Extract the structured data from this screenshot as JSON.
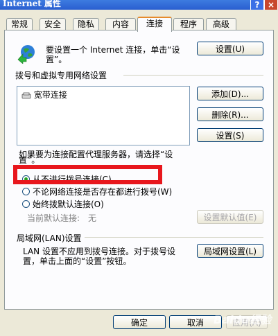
{
  "window": {
    "title": "Internet 属性",
    "help": "?",
    "close": "×"
  },
  "tabs": [
    {
      "label": "常规"
    },
    {
      "label": "安全"
    },
    {
      "label": "隐私"
    },
    {
      "label": "内容"
    },
    {
      "label": "连接"
    },
    {
      "label": "程序"
    },
    {
      "label": "高级"
    }
  ],
  "setup": {
    "text_line1": "要设置一个 Internet 连接，单击“设",
    "text_line2": "置”。",
    "button": "设置(U)"
  },
  "dialup": {
    "heading": "拨号和虚拟专用网络设置",
    "items": [
      "宽带连接"
    ],
    "add_button": "添加(D)...",
    "delete_button": "删除(R)...",
    "settings_button": "设置(S)"
  },
  "proxy_hint": {
    "line1": "如果要为连接配置代理服务器，请选择“设",
    "line2": "置”。"
  },
  "options": {
    "never": "从不进行拨号连接(C)",
    "when_no_network": "不论网络连接是否存在都进行拨号(W)",
    "always": "始终拨默认连接(O)"
  },
  "default_connection": {
    "label": "当前默认连接:",
    "value": "无",
    "button": "设置默认值(E)"
  },
  "lan": {
    "heading": "局域网(LAN)设置",
    "line1": "LAN 设置不应用到拨号连接。对于拨号设",
    "line2": "置，单击上面的“设置”按钮。",
    "button": "局域网设置(L)"
  },
  "footer": {
    "ok": "确定",
    "cancel": "取消",
    "apply": "应用(A)"
  },
  "watermark": "Baidu经验"
}
